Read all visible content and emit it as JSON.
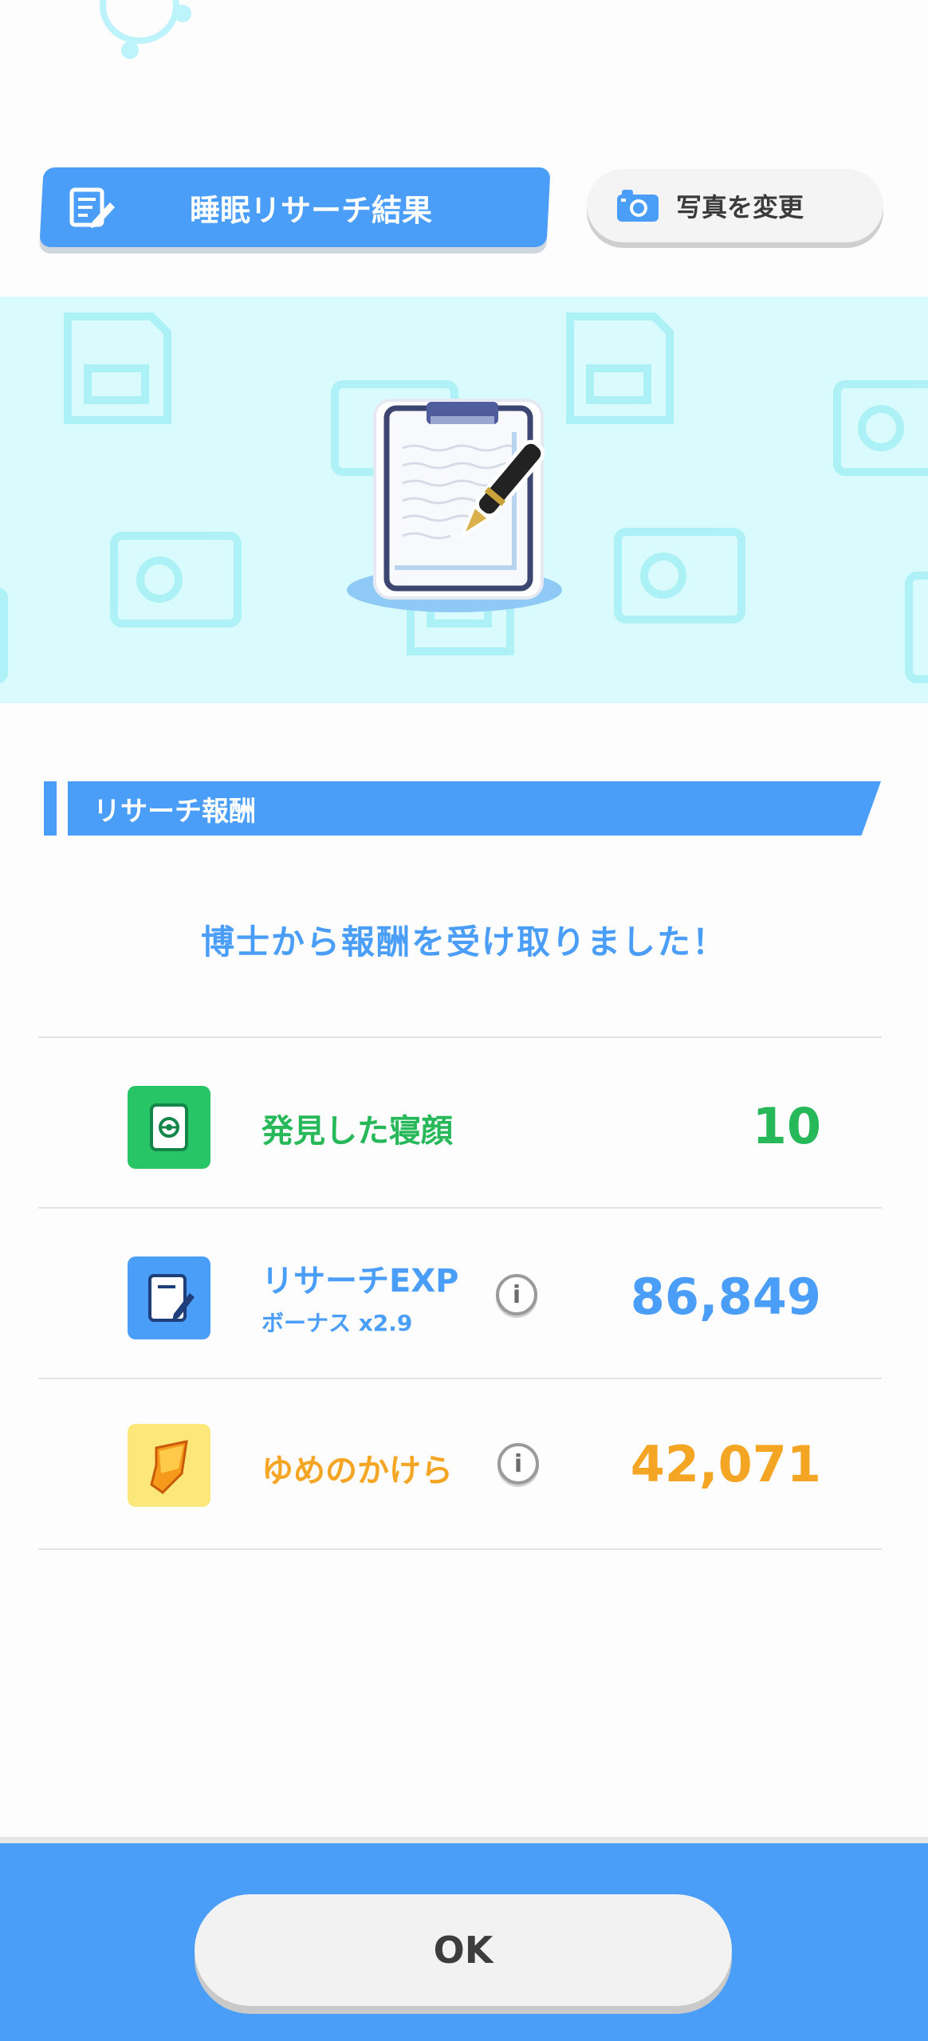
{
  "header": {
    "tab_label": "睡眠リサーチ結果",
    "photo_button_label": "写真を変更"
  },
  "section": {
    "title": "リサーチ報酬"
  },
  "message": "博士から報酬を受け取りました！",
  "rewards": [
    {
      "label": "発見した寝顔",
      "value": "10",
      "color": "#27b85a",
      "icon": "sleep-style-card-icon"
    },
    {
      "label": "リサーチEXP",
      "sublabel": "ボーナス x2.9",
      "value": "86,849",
      "color": "#4a9ef8",
      "icon": "research-note-icon"
    },
    {
      "label": "ゆめのかけら",
      "value": "42,071",
      "color": "#f5a524",
      "icon": "dream-shard-icon"
    }
  ],
  "footer": {
    "ok_label": "OK"
  },
  "colors": {
    "accent": "#4a9ef8",
    "green": "#27b85a",
    "orange": "#f5a524",
    "banner_bg": "#d9fbfd"
  }
}
